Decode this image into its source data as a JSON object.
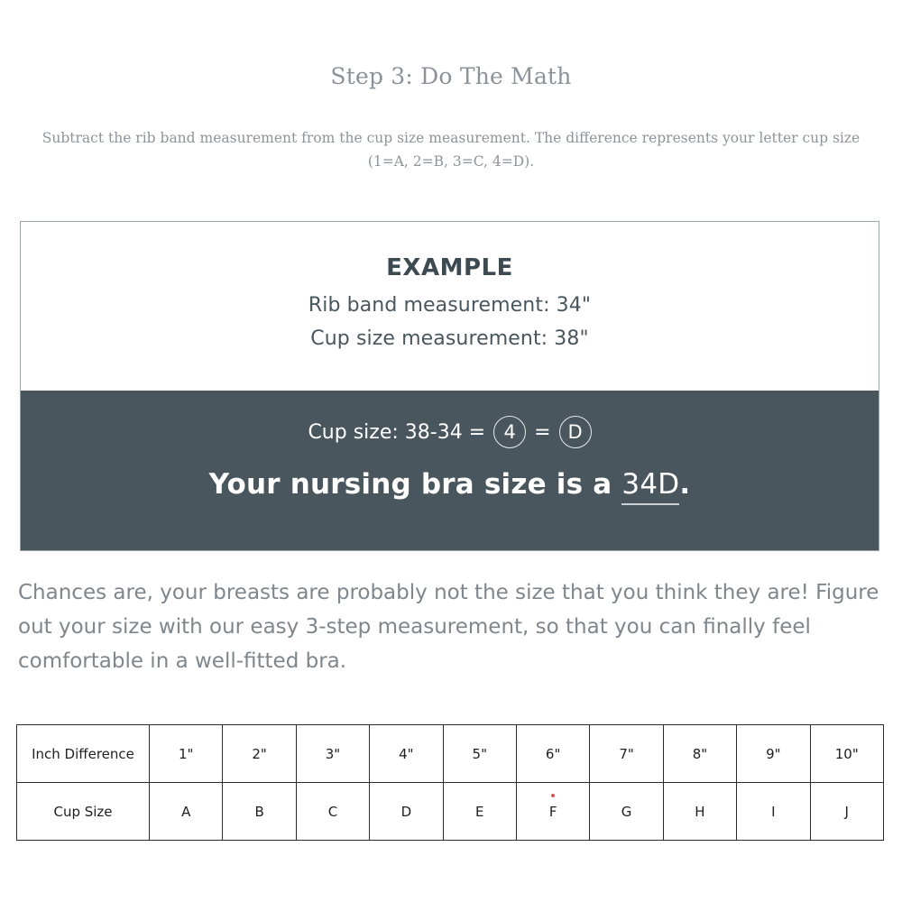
{
  "page": {
    "title": "Step 3: Do The Math",
    "intro_line_1": "Subtract the rib band measurement from the cup size measurement. The difference represents your letter cup size",
    "intro_line_2": "(1=A, 2=B, 3=C, 4=D)."
  },
  "example_card": {
    "heading": "EXAMPLE",
    "rib_band_line": "Rib band measurement: 34\"",
    "cup_size_line": "Cup size measurement: 38\"",
    "calc": {
      "prefix": "Cup size: 38-34 =",
      "circled_number": "4",
      "equals": "=",
      "circled_letter": "D"
    },
    "result": {
      "prefix": "Your nursing bra size is a",
      "size": "34D",
      "suffix": "."
    }
  },
  "body_copy": "Chances are, your breasts are probably not the size that you think they are! Figure out your size with our easy 3-step measurement, so that you can finally feel comfortable in a well-fitted bra.",
  "size_table": {
    "row_labels": [
      "Inch Difference",
      "Cup Size"
    ],
    "inch_difference": [
      "1\"",
      "2\"",
      "3\"",
      "4\"",
      "5\"",
      "6\"",
      "7\"",
      "8\"",
      "9\"",
      "10\""
    ],
    "cup_size": [
      "A",
      "B",
      "C",
      "D",
      "E",
      "F",
      "G",
      "H",
      "I",
      "J"
    ]
  },
  "colors": {
    "dark_panel": "#4a565d",
    "muted_text": "#8d949a",
    "body_text": "#7f868c",
    "table_border": "#2b2b2b",
    "speck": "#d9574f"
  }
}
